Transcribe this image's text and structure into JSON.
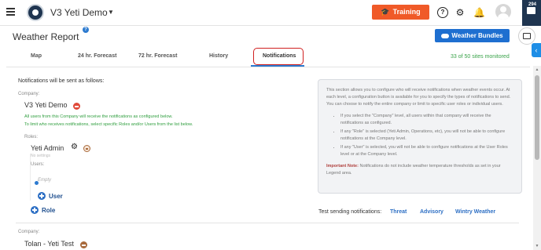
{
  "topbar": {
    "app_title": "V3 Yeti Demo",
    "training_label": "Training",
    "chat_badge": "294",
    "icons": [
      "menu-icon",
      "help-icon",
      "gear-icon",
      "bell-icon",
      "avatar",
      "chat-icon"
    ]
  },
  "header": {
    "page_title": "Weather Report",
    "bundles_label": "Weather Bundles"
  },
  "tabs": [
    {
      "label": "Map"
    },
    {
      "label": "24 hr. Forecast"
    },
    {
      "label": "72 hr. Forecast"
    },
    {
      "label": "History"
    },
    {
      "label": "Notifications",
      "active": true
    }
  ],
  "sites_monitored": "33 of 50 sites monitored",
  "notifications": {
    "lead": "Notifications will be sent as follows:",
    "company_label": "Company:",
    "company_name": "V3 Yeti Demo",
    "note_line1": "All users from this Company will receive the notifications as configured below.",
    "note_line2": "To limit who receives notifications, select specific Roles and/or Users from the list below.",
    "roles_label": "Roles:",
    "role_name": "Yeti Admin",
    "role_status": "No settings",
    "users_label": "Users:",
    "empty_text": "Empty",
    "add_user_label": "User",
    "add_role_label": "Role",
    "company2_label": "Company:",
    "company2_name": "Tolan - Yeti Test"
  },
  "info": {
    "intro": "This section allows you to configure who will receive notifications when weather events occur. At each level, a configuration button is available for you to specify the types of notifications to send. You can choose to notify the entire company or limit to specific user roles or individual users.",
    "bullet1": "If you select the \"Company\" level, all users within that company will receive the notifications as configured.",
    "bullet2": "If any \"Role\" is selected (Yeti Admin, Operations, etc), you will not be able to configure notifications at the Company level.",
    "bullet3": "If any \"User\" is selected, you will not be able to configure notifications at the User Roles level or at the Company level.",
    "important_label": "Important Note:",
    "important_text": " Notifications do not include weather temperature thresholds as set in your Legend area."
  },
  "test": {
    "label": "Test sending notifications:",
    "links": [
      "Threat",
      "Advisory",
      "Wintry Weather"
    ]
  },
  "colors": {
    "brand_navy": "#1f3550",
    "training_orange": "#f05a28",
    "primary_blue": "#1e6fd0",
    "active_outline_red": "#d02020",
    "green_text": "#2f9e3e"
  }
}
